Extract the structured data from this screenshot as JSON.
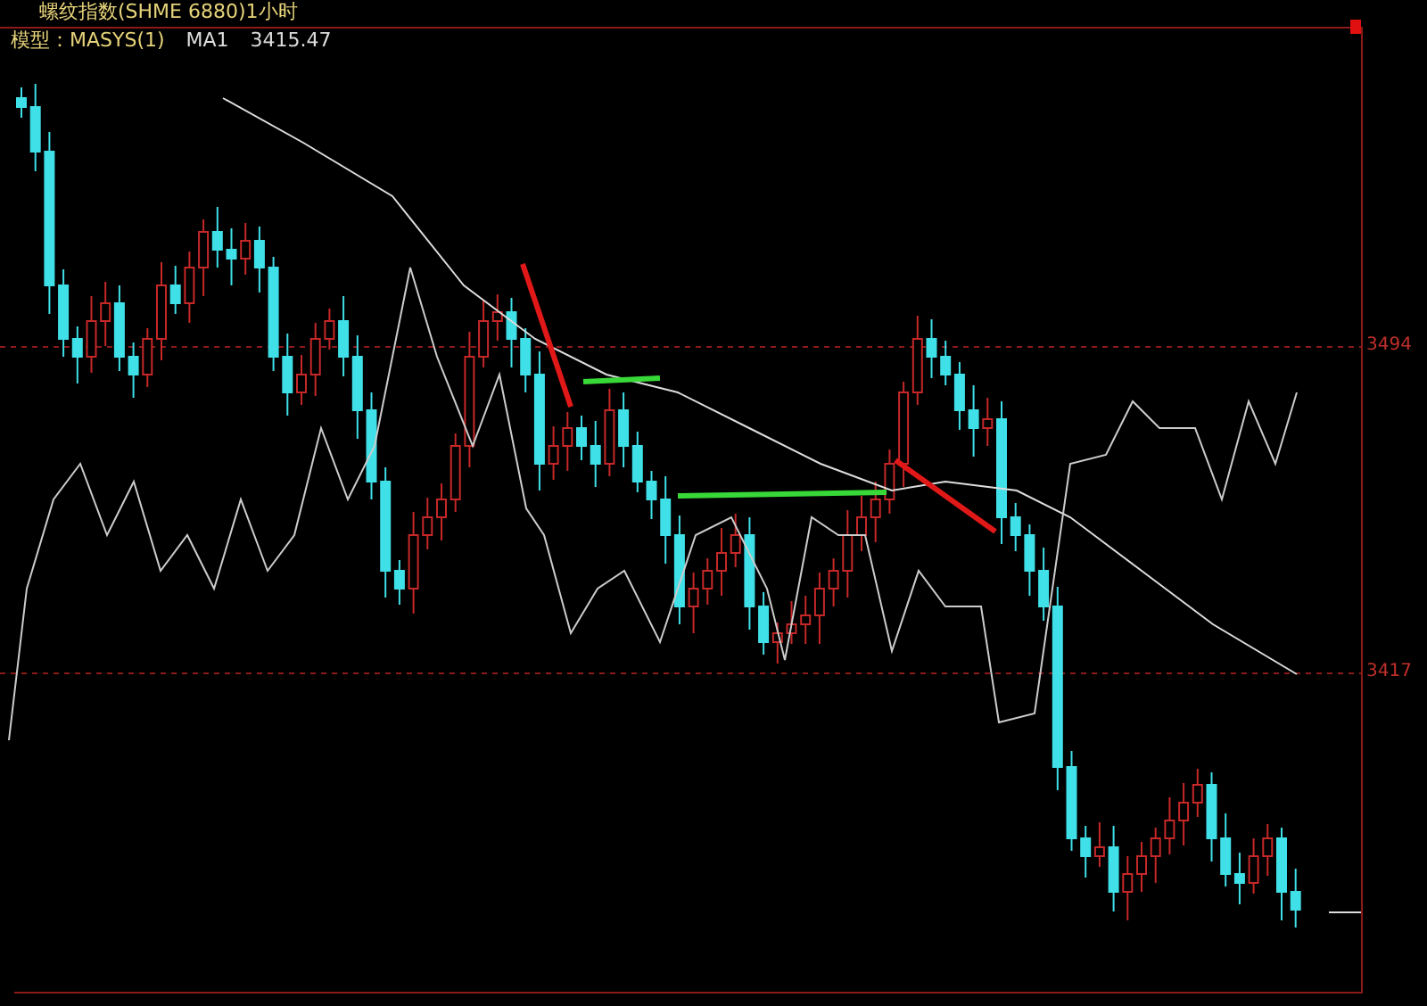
{
  "chart": {
    "title": "螺纹指数(SHME 6880)1小时",
    "indicator": {
      "model": "模型：MASYS(1)",
      "ma_label": "MA1",
      "ma_value": "3415.47"
    },
    "price_labels": [
      "3494",
      "3417"
    ]
  }
}
